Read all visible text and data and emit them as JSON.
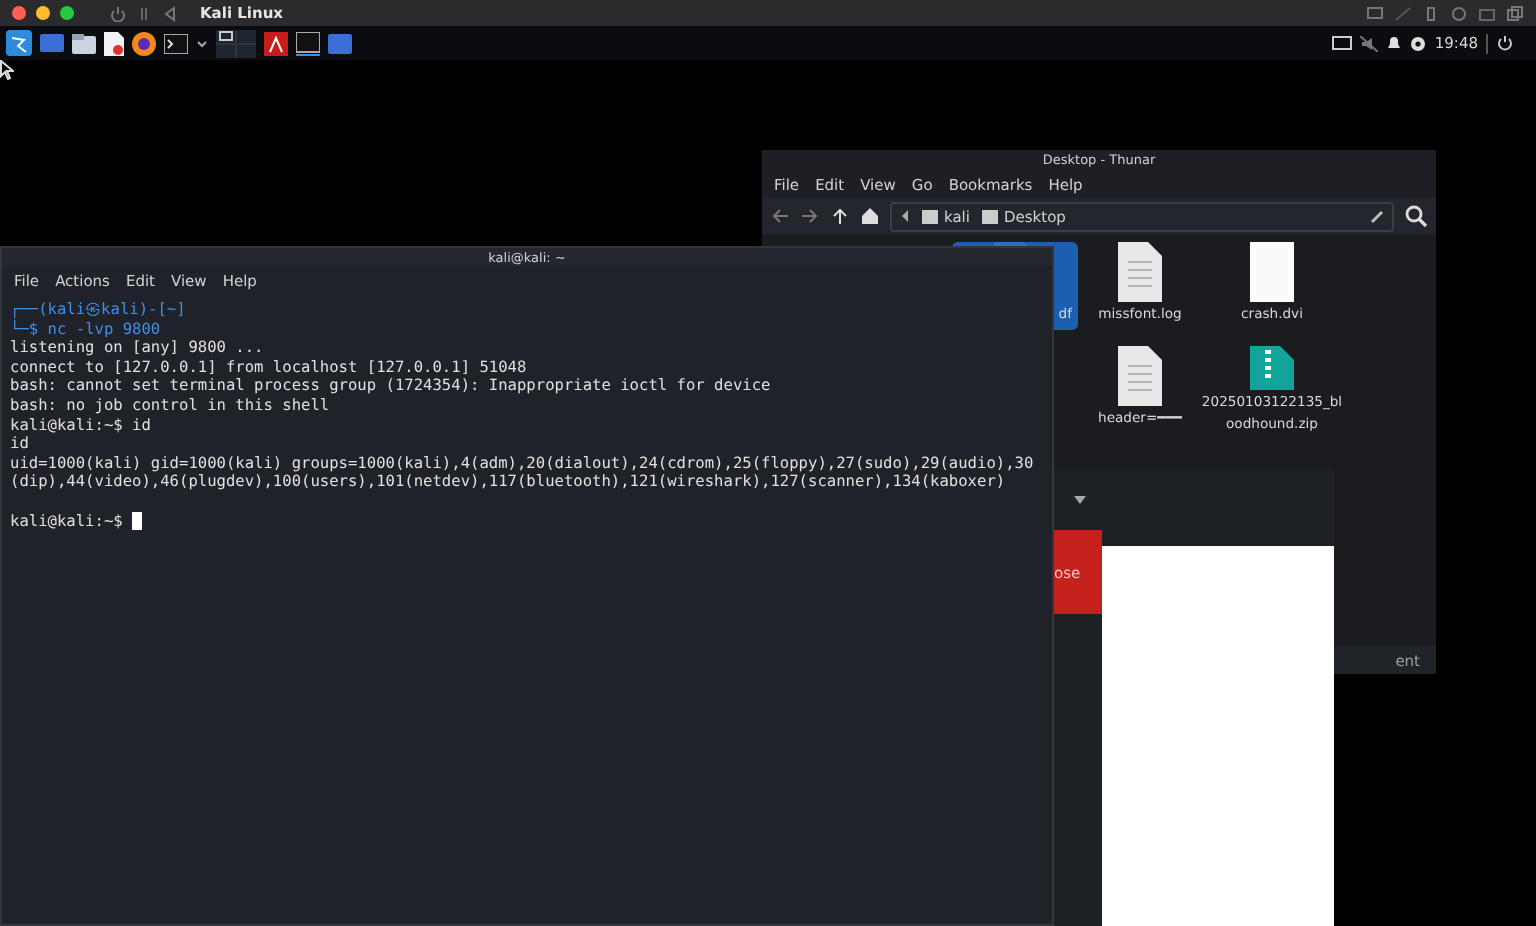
{
  "host_bar": {
    "title": "Kali Linux"
  },
  "panel": {
    "clock": "19:48"
  },
  "file_manager": {
    "title": "Desktop - Thunar",
    "menu": [
      "File",
      "Edit",
      "View",
      "Go",
      "Bookmarks",
      "Help"
    ],
    "path": [
      "kali",
      "Desktop"
    ],
    "files": [
      {
        "kind": "pdf",
        "lines": [
          "df"
        ],
        "selected": true
      },
      {
        "kind": "text",
        "lines": [
          "missfont.log"
        ],
        "selected": false
      },
      {
        "kind": "blank",
        "lines": [
          "crash.dvi"
        ],
        "selected": false
      },
      {
        "kind": "text",
        "lines": [
          "header=━━━"
        ],
        "selected": false
      },
      {
        "kind": "zip",
        "lines": [
          "20250103122135_bl",
          "oodhound.zip"
        ],
        "selected": false
      }
    ],
    "status_fragment": "ent"
  },
  "viewer": {
    "close_fragment": "ose"
  },
  "terminal": {
    "title": "kali@kali: ~",
    "menu": [
      "File",
      "Actions",
      "Edit",
      "View",
      "Help"
    ],
    "lines": [
      {
        "kind": "prompt_head",
        "text": "┌──(kali㉿kali)-[~]"
      },
      {
        "kind": "command",
        "prompt": "└─$",
        "text": "nc -lvp 9800"
      },
      {
        "kind": "output",
        "text": "listening on [any] 9800 ..."
      },
      {
        "kind": "output",
        "text": "connect to [127.0.0.1] from localhost [127.0.0.1] 51048"
      },
      {
        "kind": "output",
        "text": "bash: cannot set terminal process group (1724354): Inappropriate ioctl for device"
      },
      {
        "kind": "output",
        "text": "bash: no job control in this shell"
      },
      {
        "kind": "output",
        "text": "kali@kali:~$ id"
      },
      {
        "kind": "output",
        "text": "id"
      },
      {
        "kind": "output",
        "text": "uid=1000(kali) gid=1000(kali) groups=1000(kali),4(adm),20(dialout),24(cdrom),25(floppy),27(sudo),29(audio),30"
      },
      {
        "kind": "output",
        "text": "(dip),44(video),46(plugdev),100(users),101(netdev),117(bluetooth),121(wireshark),127(scanner),134(kaboxer)"
      },
      {
        "kind": "gap"
      },
      {
        "kind": "cursor",
        "text": "kali@kali:~$"
      }
    ]
  }
}
